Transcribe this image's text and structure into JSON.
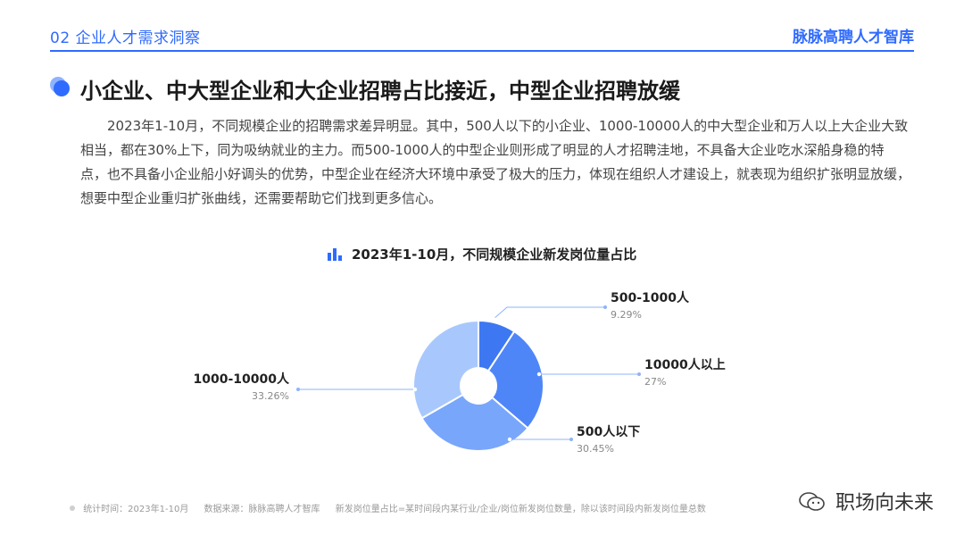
{
  "header": {
    "section": "02 企业人才需求洞察",
    "brand": "脉脉高聘人才智库"
  },
  "title": "小企业、中大型企业和大企业招聘占比接近，中型企业招聘放缓",
  "paragraph": "2023年1-10月，不同规模企业的招聘需求差异明显。其中，500人以下的小企业、1000-10000人的中大型企业和万人以上大企业大致相当，都在30%上下，同为吸纳就业的主力。而500-1000人的中型企业则形成了明显的人才招聘洼地，不具备大企业吃水深船身稳的特点，也不具备小企业船小好调头的优势，中型企业在经济大环境中承受了极大的压力，体现在组织人才建设上，就表现为组织扩张明显放缓，想要中型企业重归扩张曲线，还需要帮助它们找到更多信心。",
  "chart_data": {
    "type": "pie",
    "title": "2023年1-10月，不同规模企业新发岗位量占比",
    "slices": [
      {
        "label": "500-1000人",
        "value": 9.29,
        "value_label": "9.29%",
        "color": "#3d78f2"
      },
      {
        "label": "10000人以上",
        "value": 27,
        "value_label": "27%",
        "color": "#4f86f7"
      },
      {
        "label": "500人以下",
        "value": 30.45,
        "value_label": "30.45%",
        "color": "#78a6fb"
      },
      {
        "label": "1000-10000人",
        "value": 33.26,
        "value_label": "33.26%",
        "color": "#a8c8fd"
      }
    ],
    "donut": true,
    "legend": "callout-labels"
  },
  "footer": {
    "stat_time": "统计时间：2023年1-10月",
    "source": "数据来源：脉脉高聘人才智库",
    "note": "新发岗位量占比=某时间段内某行业/企业/岗位新发岗位数量，除以该时间段内新发岗位量总数"
  },
  "watermark": "职场向未来",
  "colors": {
    "accent": "#2f6bff",
    "leader_line": "#8fb3fb"
  }
}
